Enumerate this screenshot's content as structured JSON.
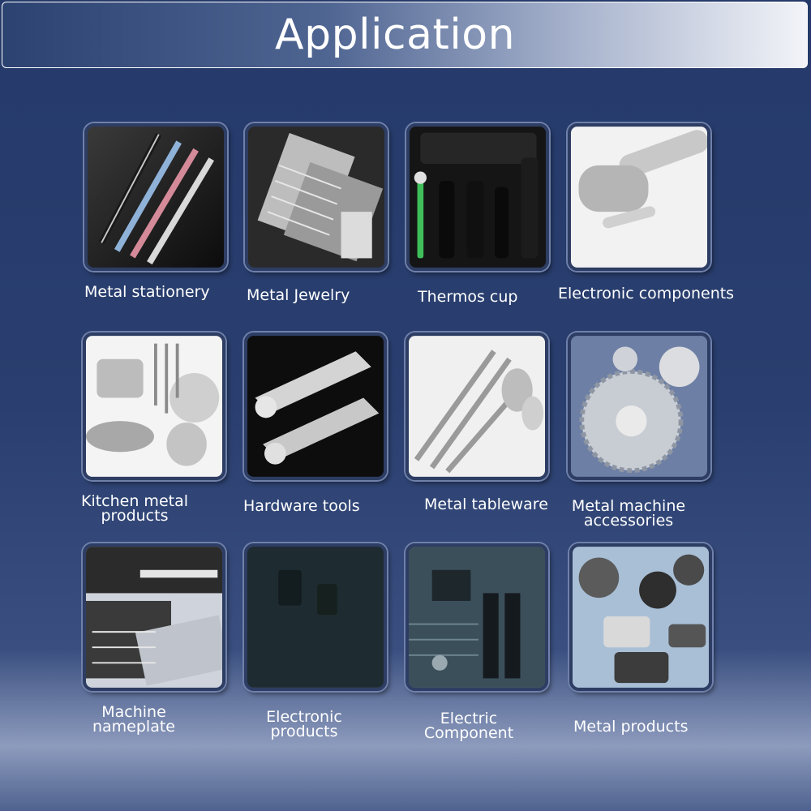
{
  "header": {
    "title": "Application"
  },
  "items": [
    {
      "label_lines": [
        "Metal stationery"
      ],
      "icon": "pens-icon"
    },
    {
      "label_lines": [
        "Metal Jewelry"
      ],
      "icon": "jewelry-case-icon"
    },
    {
      "label_lines": [
        "Thermos cup"
      ],
      "icon": "thermos-icon"
    },
    {
      "label_lines": [
        "Electronic components"
      ],
      "icon": "faucet-icon"
    },
    {
      "label_lines": [
        "Kitchen metal",
        "products"
      ],
      "icon": "cookware-icon"
    },
    {
      "label_lines": [
        "Hardware tools"
      ],
      "icon": "wrench-icon"
    },
    {
      "label_lines": [
        "Metal tableware"
      ],
      "icon": "tableware-icon"
    },
    {
      "label_lines": [
        "Metal machine",
        "accessories"
      ],
      "icon": "saw-blade-icon"
    },
    {
      "label_lines": [
        "Machine",
        "nameplate"
      ],
      "icon": "nameplate-icon"
    },
    {
      "label_lines": [
        "Electronic",
        "products"
      ],
      "icon": "dark-device-icon"
    },
    {
      "label_lines": [
        "Electric",
        "Component"
      ],
      "icon": "circuit-board-icon"
    },
    {
      "label_lines": [
        "Metal products"
      ],
      "icon": "metal-tags-icon"
    }
  ]
}
